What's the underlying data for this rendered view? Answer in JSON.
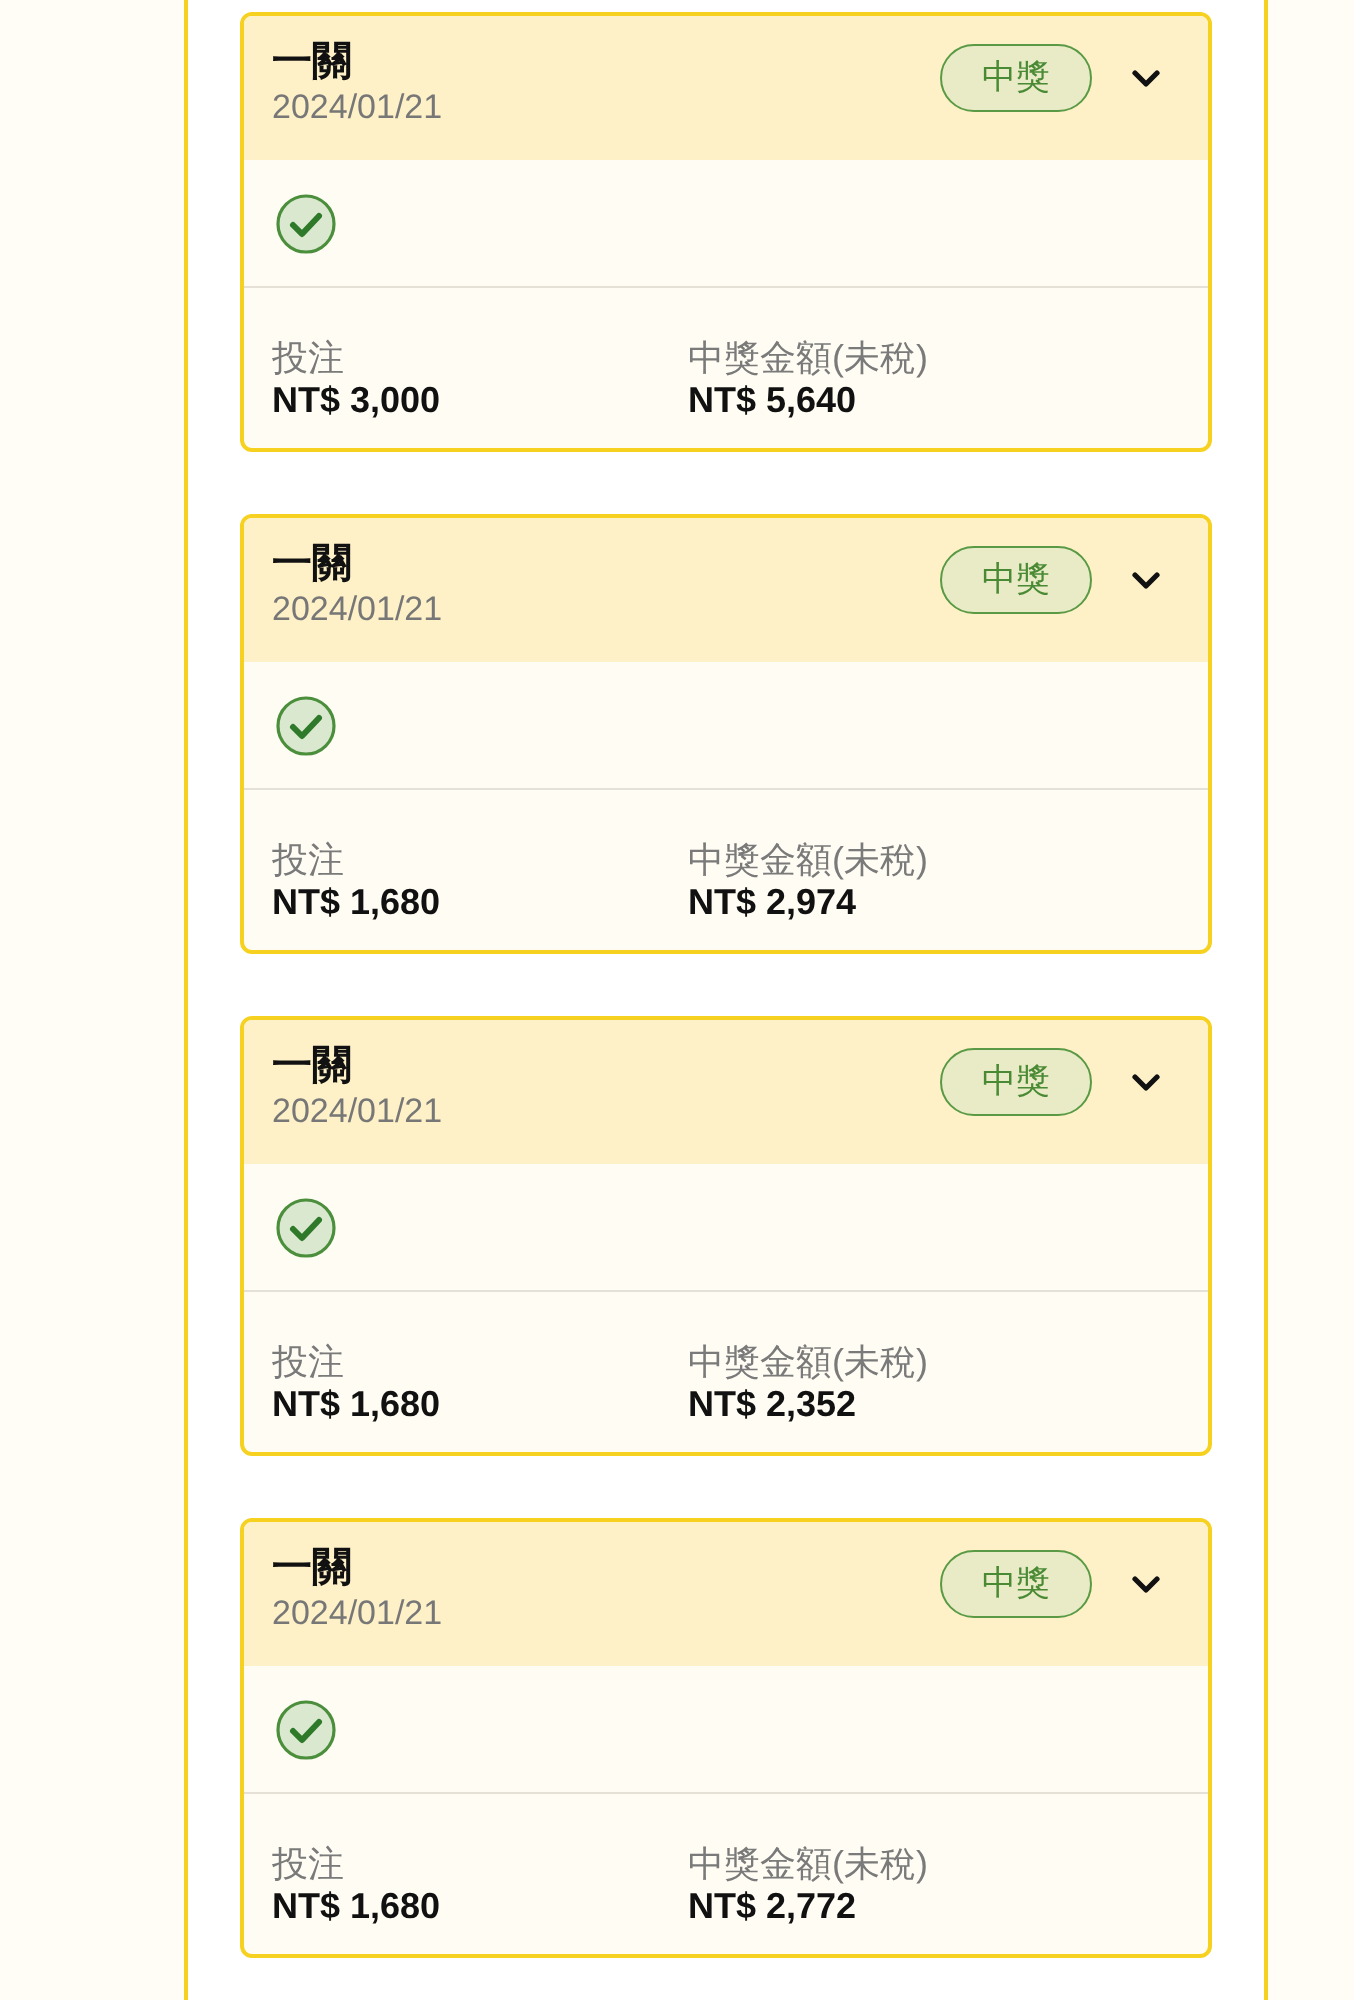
{
  "cards": [
    {
      "title": "一關",
      "date": "2024/01/21",
      "badge": "中獎",
      "expanded": false,
      "legs": [
        {
          "kind": "win"
        }
      ],
      "amounts": [
        {
          "label": "投注",
          "value": "NT$ 3,000"
        },
        {
          "label": "中獎金額(未稅)",
          "value": "NT$ 5,640"
        }
      ]
    },
    {
      "title": "一關",
      "date": "2024/01/21",
      "badge": "中獎",
      "expanded": false,
      "legs": [
        {
          "kind": "win"
        }
      ],
      "amounts": [
        {
          "label": "投注",
          "value": "NT$ 1,680"
        },
        {
          "label": "中獎金額(未稅)",
          "value": "NT$ 2,974"
        }
      ]
    },
    {
      "title": "一關",
      "date": "2024/01/21",
      "badge": "中獎",
      "expanded": false,
      "legs": [
        {
          "kind": "win"
        }
      ],
      "amounts": [
        {
          "label": "投注",
          "value": "NT$ 1,680"
        },
        {
          "label": "中獎金額(未稅)",
          "value": "NT$ 2,352"
        }
      ]
    },
    {
      "title": "一關",
      "date": "2024/01/21",
      "badge": "中獎",
      "expanded": false,
      "legs": [
        {
          "kind": "win"
        }
      ],
      "amounts": [
        {
          "label": "投注",
          "value": "NT$ 1,680"
        },
        {
          "label": "中獎金額(未稅)",
          "value": "NT$ 2,772"
        }
      ]
    }
  ]
}
